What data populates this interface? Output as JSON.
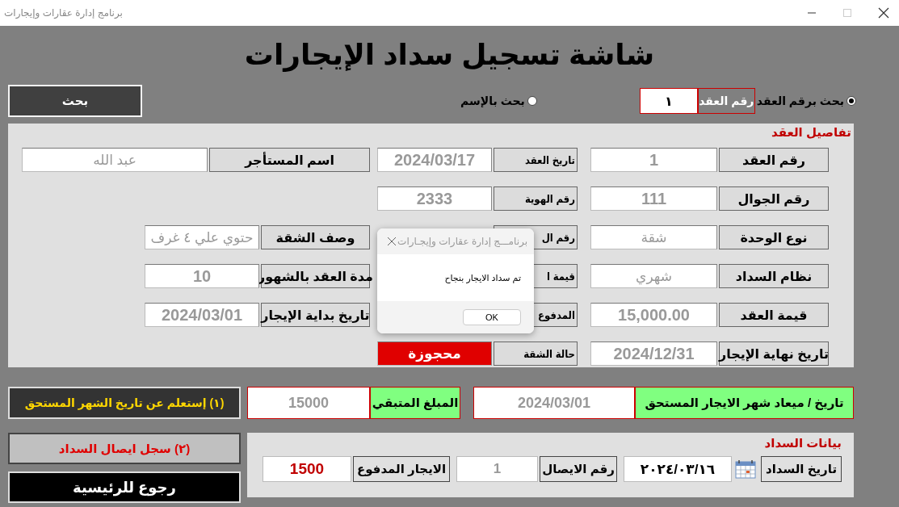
{
  "window": {
    "title": "برنامج إدارة عقارات وإيجارات"
  },
  "heading": "شاشة تسجيل سداد الإيجارات",
  "search": {
    "button": "بحث",
    "field_label": "رقم العقد",
    "field_value": "١",
    "options": [
      {
        "label": "بحث برقم العقد",
        "selected": true
      },
      {
        "label": "بحث بالإسم",
        "selected": false
      }
    ]
  },
  "contract_details": {
    "title": "تفاصيل العقد",
    "rows": [
      [
        {
          "label": "رقم العقد",
          "value": "1",
          "kind": "number"
        },
        {
          "label": "تاريخ العقد",
          "value": "2024/03/17",
          "kind": "number"
        },
        {
          "label": "اسم المستأجر",
          "value": "عبد الله",
          "kind": "text"
        }
      ],
      [
        {
          "label": "رقم الجوال",
          "value": "111",
          "kind": "number"
        },
        {
          "label": "رقم الهوية",
          "value": "2333",
          "kind": "number"
        }
      ],
      [
        {
          "label": "نوع الوحدة",
          "value": "شقة",
          "kind": "text"
        },
        {
          "label": "رقم ال"
        },
        {
          "label": "وصف الشقة",
          "value": "حتوي علي ٤ غرف",
          "kind": "text"
        }
      ],
      [
        {
          "label": "نظام السداد",
          "value": "شهري",
          "kind": "text"
        },
        {
          "label": "قيمة ا"
        },
        {
          "label": "مدة العقد بالشهور",
          "value": "10",
          "kind": "number"
        }
      ],
      [
        {
          "label": "قيمة العقد",
          "value": "15,000.00",
          "kind": "number"
        },
        {
          "label": "المدفوع"
        },
        {
          "label": "تاريخ بداية الإيجار",
          "value": "2024/03/01",
          "kind": "number"
        }
      ],
      [
        {
          "label": "تاريخ نهاية الإيجار",
          "value": "2024/12/31",
          "kind": "number"
        },
        {
          "label": "حالة الشقة",
          "value": "محجوزة",
          "kind": "status"
        }
      ]
    ]
  },
  "due": {
    "query_button": "(١) إستعلم عن تاريخ  الشهر المستحق",
    "due_date_label": "تاريخ / ميعاد شهر الايجار المستحق",
    "due_date_value": "2024/03/01",
    "remaining_label": "المبلغ المتبقي",
    "remaining_value": "15000"
  },
  "actions": {
    "save_receipt": "(٢) سجل ايصال السداد",
    "home": "رجوع للرئيسية"
  },
  "payment": {
    "title": "بيانات السداد",
    "fields": [
      {
        "label": "تاريخ السداد",
        "value": "٢٠٢٤/٠٣/١٦",
        "kind": "date"
      },
      {
        "label": "رقم الايصال",
        "value": "1",
        "kind": "text"
      },
      {
        "label": "الايجار المدفوع",
        "value": "1500",
        "kind": "amount"
      }
    ]
  },
  "dialog": {
    "title": "برنامـــج إدارة عقارات وإيجـارات",
    "message": "تم  سداد الايجار بنجاح",
    "button": "OK"
  }
}
